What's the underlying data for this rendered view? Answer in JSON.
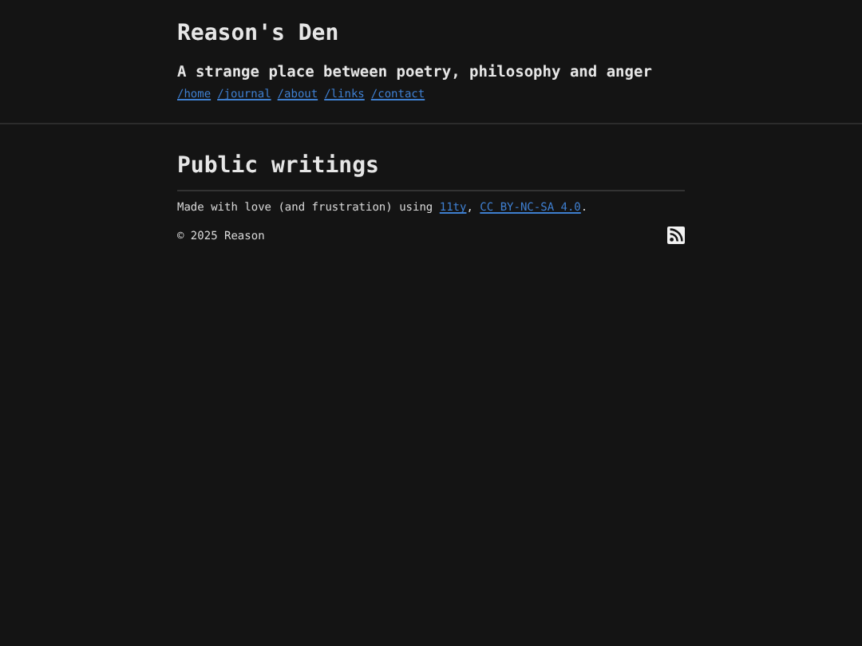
{
  "site": {
    "title": "Reason's Den",
    "tagline": "A strange place between poetry, philosophy and anger"
  },
  "nav": [
    {
      "label": "/home"
    },
    {
      "label": "/journal"
    },
    {
      "label": "/about"
    },
    {
      "label": "/links"
    },
    {
      "label": "/contact"
    }
  ],
  "heading": "Public writings",
  "footer": {
    "credit_before": "Made with love (and frustration) using ",
    "credit_links": [
      "11ty",
      "CC BY-NC-SA 4.0"
    ],
    "credit_separator": ", ",
    "credit_after": ".",
    "copyright": "© 2025 Reason"
  }
}
